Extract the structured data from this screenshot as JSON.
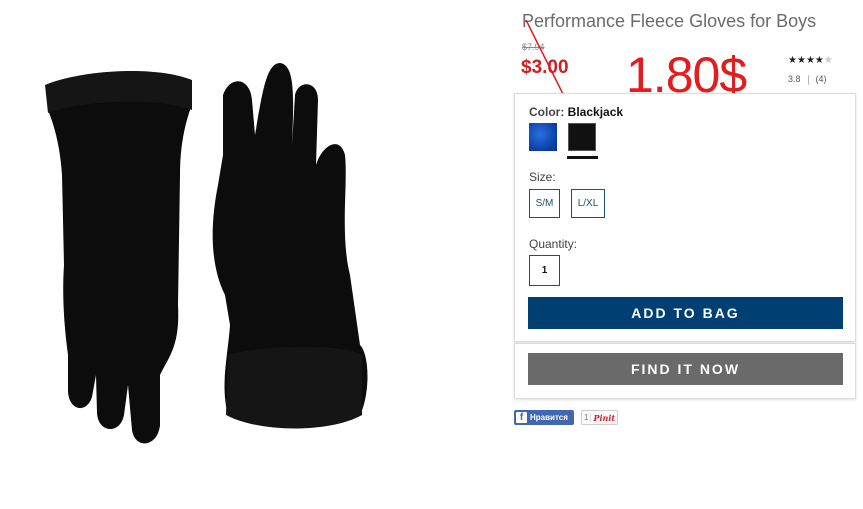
{
  "product": {
    "title": "Performance Fleece Gloves for Boys",
    "original_price": "$7.94",
    "sale_price": "$3.00",
    "image_icon": "black-fleece-gloves-image"
  },
  "annotation": {
    "handwritten_price": "1.80$",
    "color": "#e21d1d"
  },
  "rating": {
    "stars_filled": 4,
    "stars_total": 5,
    "score": "3.8",
    "count": "(4)"
  },
  "options": {
    "color_label": "Color:",
    "color_value": "Blackjack",
    "swatches": [
      {
        "name": "blue",
        "color": "#0a3fa8",
        "selected": false
      },
      {
        "name": "blackjack",
        "color": "#111111",
        "selected": true
      }
    ],
    "size_label": "Size:",
    "sizes": [
      "S/M",
      "L/XL"
    ],
    "quantity_label": "Quantity:",
    "quantity_value": "1"
  },
  "actions": {
    "add_to_bag": "ADD TO BAG",
    "find_it_now": "FIND IT NOW"
  },
  "social": {
    "facebook_like": "Нравится",
    "pin_count": "1",
    "pin_label": "Pinit"
  },
  "colors": {
    "sale_red": "#cc1f1f",
    "primary_blue": "#003f72",
    "secondary_gray": "#6a6a6a",
    "facebook_blue": "#4267b2"
  }
}
